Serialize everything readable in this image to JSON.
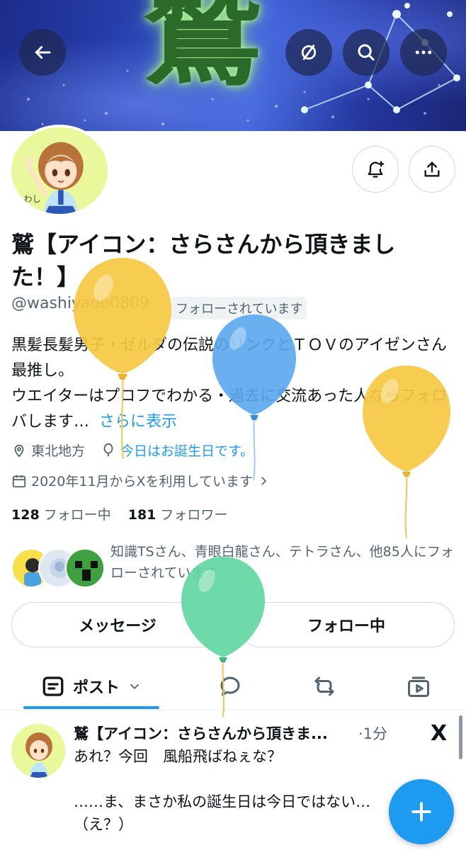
{
  "header": {
    "banner_glyph": "鷲",
    "back_icon": "arrow-left-icon",
    "hide_icon": "eye-slash-icon",
    "search_icon": "search-icon",
    "more_icon": "more-horizontal-icon"
  },
  "profile": {
    "display_name": "鷲【アイコン：さらさんから頂きました！】",
    "handle": "@washiyade0809",
    "follows_you": "フォローされています",
    "bio": "黒髪長髪男子・ゼルダの伝説のリンクとＴＯＶのアイゼンさん最推し。\nウエイターはプロフでわかる・過去に交流あった人ならフォロバします…",
    "show_more": "さらに表示",
    "location": "東北地方",
    "birthday": "今日はお誕生日です。",
    "joined": "2020年11月からXを利用しています",
    "following_count": "128",
    "following_label": "フォロー中",
    "followers_count": "181",
    "followers_label": "フォロワー",
    "known_followers": "知識TSさん、青眼白龍さん、テトラさん、他85人にフォローされています",
    "avatar_caption": "わし"
  },
  "actions": {
    "message_label": "メッセージ",
    "following_button_label": "フォロー中"
  },
  "tabs": {
    "posts_label": "ポスト"
  },
  "post": {
    "author": "鷲【アイコン：さらさんから頂きま...",
    "time": "·1分",
    "source_mark": "X",
    "body": "あれ？今回　風船飛ばねぇな？\n\n……ま、まさか私の誕生日は今日ではない…\n（え？）"
  },
  "colors": {
    "accent": "#1d9bf0",
    "text_primary": "#0f1419",
    "text_secondary": "#536471",
    "balloon_yellow": "#f5c842",
    "balloon_blue": "#5aa7f0",
    "balloon_green": "#5fd6a0"
  }
}
